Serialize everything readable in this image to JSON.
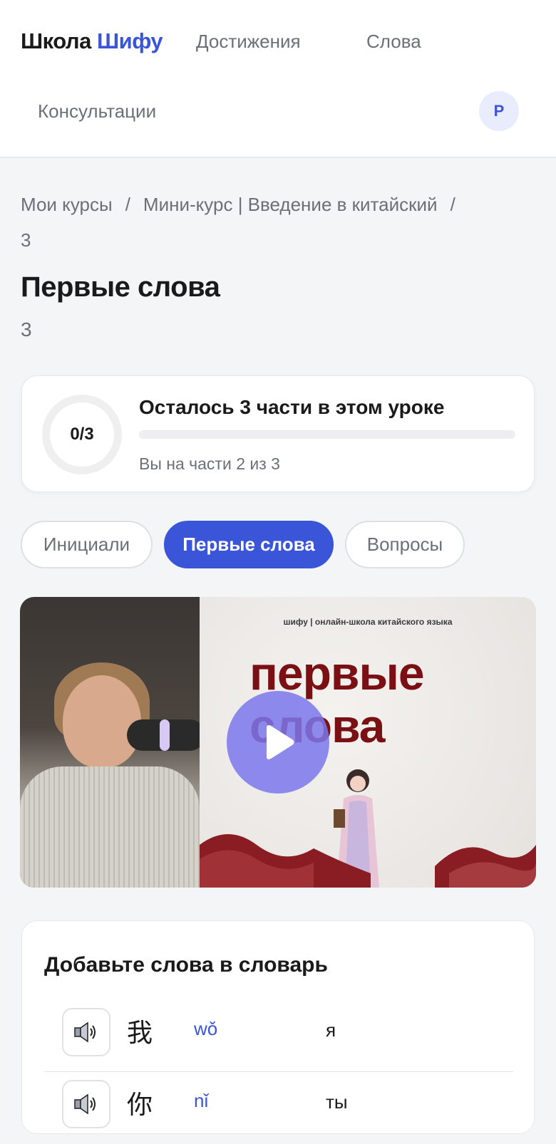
{
  "header": {
    "logo_main": "Школа",
    "logo_accent": "Шифу",
    "nav": [
      "Достижения",
      "Слова",
      "Консультации"
    ],
    "avatar_initial": "Р"
  },
  "breadcrumb": {
    "items": [
      "Мои курсы",
      "Мини-курс | Введение в китайский",
      "3"
    ],
    "separator": "/"
  },
  "lesson": {
    "title": "Первые слова",
    "subtitle": "3"
  },
  "progress": {
    "counter": "0/3",
    "title": "Осталось 3 части в этом уроке",
    "subtitle": "Вы на части 2 из 3",
    "fraction": 0
  },
  "tabs": [
    {
      "label": "Инициали",
      "active": false
    },
    {
      "label": "Первые слова",
      "active": true
    },
    {
      "label": "Вопросы",
      "active": false
    }
  ],
  "video": {
    "caption": "шифу | онлайн-школа китайского языка",
    "slide_title": "первые слова",
    "play_icon": "play-icon",
    "play_color": "#7b77ec"
  },
  "words": {
    "title": "Добавьте слова в словарь",
    "speaker_icon": "speaker-icon",
    "items": [
      {
        "hanzi": "我",
        "pinyin": "wǒ",
        "meaning": "я"
      },
      {
        "hanzi": "你",
        "pinyin": "nǐ",
        "meaning": "ты"
      }
    ]
  },
  "colors": {
    "accent": "#3a55d8",
    "slide_title": "#7a0f14"
  }
}
